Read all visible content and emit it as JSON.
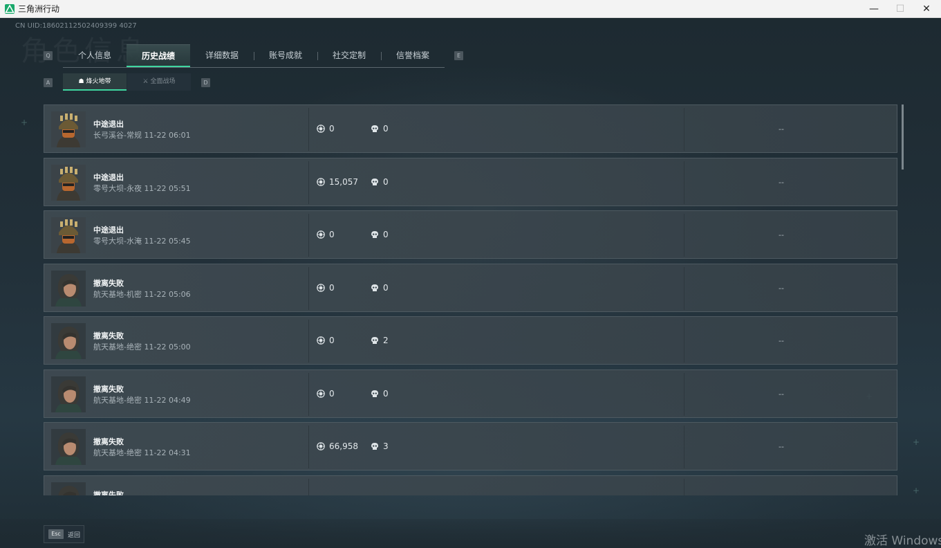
{
  "window": {
    "title": "三角洲行动",
    "min_label": "—",
    "max_label": "☐",
    "close_label": "✕"
  },
  "header": {
    "uid": "CN UID:18602112502409399 4027",
    "watermark": "角色信息"
  },
  "keys": {
    "prev_tab": "Q",
    "next_tab": "E",
    "prev_sub": "A",
    "next_sub": "D"
  },
  "tabs": [
    {
      "label": "个人信息",
      "active": false
    },
    {
      "label": "历史战绩",
      "active": true
    },
    {
      "label": "详细数据",
      "active": false
    },
    {
      "label": "账号成就",
      "active": false
    },
    {
      "label": "社交定制",
      "active": false
    },
    {
      "label": "信誉档案",
      "active": false
    }
  ],
  "subtabs": [
    {
      "label": "烽火地带",
      "icon": "☗",
      "active": true
    },
    {
      "label": "全面战场",
      "icon": "⚔",
      "active": false
    }
  ],
  "records": [
    {
      "outcome": "中途退出",
      "map": "长弓溪谷-常规",
      "time": "11-22 06:01",
      "money": "0",
      "kills": "0",
      "extra": "--",
      "avatar": "helmet"
    },
    {
      "outcome": "中途退出",
      "map": "零号大坝-永夜",
      "time": "11-22 05:51",
      "money": "15,057",
      "kills": "0",
      "extra": "--",
      "avatar": "helmet"
    },
    {
      "outcome": "中途退出",
      "map": "零号大坝-水淹",
      "time": "11-22 05:45",
      "money": "0",
      "kills": "0",
      "extra": "--",
      "avatar": "helmet"
    },
    {
      "outcome": "撤离失败",
      "map": "航天基地-机密",
      "time": "11-22 05:06",
      "money": "0",
      "kills": "0",
      "extra": "--",
      "avatar": "woman"
    },
    {
      "outcome": "撤离失败",
      "map": "航天基地-绝密",
      "time": "11-22 05:00",
      "money": "0",
      "kills": "2",
      "extra": "--",
      "avatar": "woman"
    },
    {
      "outcome": "撤离失败",
      "map": "航天基地-绝密",
      "time": "11-22 04:49",
      "money": "0",
      "kills": "0",
      "extra": "--",
      "avatar": "woman"
    },
    {
      "outcome": "撤离失败",
      "map": "航天基地-绝密",
      "time": "11-22 04:31",
      "money": "66,958",
      "kills": "3",
      "extra": "--",
      "avatar": "woman"
    },
    {
      "outcome": "撤离失败",
      "map": "",
      "time": "",
      "money": "",
      "kills": "",
      "extra": "",
      "avatar": "woman"
    }
  ],
  "footer": {
    "esc_key": "Esc",
    "back_label": "返回",
    "activate_text": "激活 Windows"
  },
  "colors": {
    "accent": "#3fd6a0",
    "row_bg": "#3f4a51"
  }
}
